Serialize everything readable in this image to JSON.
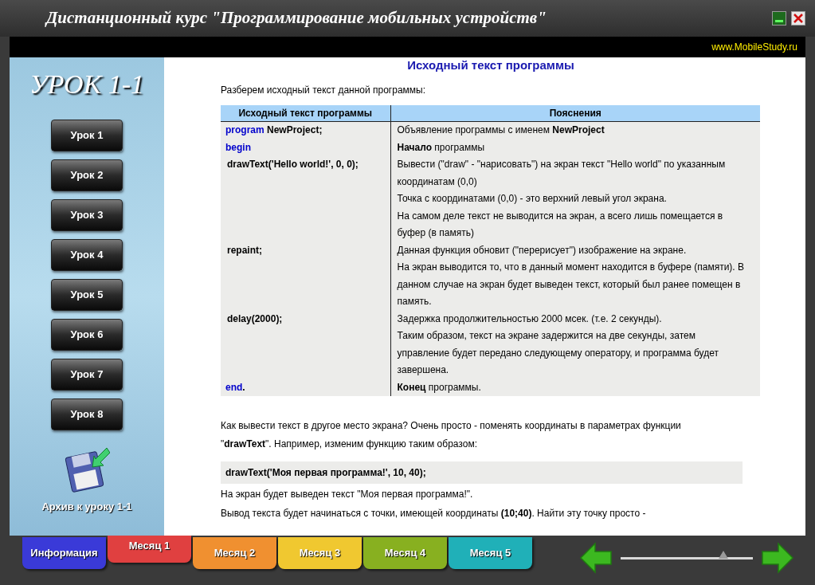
{
  "window": {
    "title": "Дистанционный курс \"Программирование мобильных устройств\"",
    "site": "www.MobileStudy.ru"
  },
  "sidebar": {
    "title": "УРОК 1-1",
    "lessons": [
      {
        "label": "Урок 1"
      },
      {
        "label": "Урок 2"
      },
      {
        "label": "Урок 3"
      },
      {
        "label": "Урок 4"
      },
      {
        "label": "Урок 5"
      },
      {
        "label": "Урок 6"
      },
      {
        "label": "Урок 7"
      },
      {
        "label": "Урок 8"
      }
    ],
    "archive": "Архив к уроку 1-1"
  },
  "content": {
    "heading": "Исходный текст программы",
    "intro": "Разберем исходный текст данной программы:",
    "table": {
      "columns": [
        "Исходный текст программы",
        "Пояснения"
      ],
      "rows": [
        {
          "code": [
            {
              "kind": "keyword",
              "text": "program"
            },
            {
              "kind": "statement",
              "text": "NewProject;"
            }
          ],
          "notes": [
            "Объявление программы с именем **NewProject**"
          ]
        },
        {
          "code": [
            {
              "kind": "keyword",
              "text": "begin"
            }
          ],
          "notes": [
            "**Начало** программы"
          ]
        },
        {
          "code": [
            {
              "kind": "statement",
              "text": "drawText('Hello world!', 0, 0);"
            }
          ],
          "notes": [
            "Вывести (\"draw\" - \"нарисовать\") на экран текст \"Hello world\" по указанным координатам (0,0)",
            "Точка с координатами (0,0) - это верхний левый угол экрана.",
            "На самом деле текст не выводится на экран, а всего лишь помещается в буфер (в память)"
          ]
        },
        {
          "code": [
            {
              "kind": "statement",
              "text": "repaint;"
            }
          ],
          "notes": [
            "Данная функция обновит (\"перерисует\") изображение на экране.",
            "На экран выводится то, что в данный момент находится в буфере (памяти). В данном случае на экран будет выведен текст, который был ранее помещен в память."
          ]
        },
        {
          "code": [
            {
              "kind": "statement",
              "text": "delay(2000);"
            }
          ],
          "notes": [
            "Задержка продолжительностью 2000 мсек. (т.е. 2 секунды).",
            "Таким образом, текст на экране задержится на две секунды, затем управление будет передано следующему оператору, и программа будет завершена."
          ]
        },
        {
          "code": [
            {
              "kind": "keyword",
              "text": "end"
            },
            {
              "kind": "punct",
              "text": "."
            }
          ],
          "notes": [
            "**Конец** программы."
          ]
        }
      ]
    },
    "paragraph": "Как вывести текст в другое место экрана? Очень просто - поменять координаты в параметрах функции \"**drawText**\". Например, изменим функцию таким образом:",
    "code_example": "drawText('Моя первая программа!', 10, 40);",
    "after": [
      "На экран будет выведен текст \"Моя первая программа!\".",
      "Вывод текста будет начинаться с точки, имеющей координаты **(10;40)**. Найти эту точку просто -"
    ]
  },
  "tabs": [
    {
      "label": "Информация",
      "selected": false,
      "color": "#3a3ad8"
    },
    {
      "label": "Месяц 1",
      "selected": true,
      "color": "#e04040"
    },
    {
      "label": "Месяц 2",
      "selected": false,
      "color": "#f09030"
    },
    {
      "label": "Месяц 3",
      "selected": false,
      "color": "#f0c830"
    },
    {
      "label": "Месяц 4",
      "selected": false,
      "color": "#88b020"
    },
    {
      "label": "Месяц 5",
      "selected": false,
      "color": "#20b0b8"
    }
  ],
  "slider": {
    "level": 0.78
  }
}
